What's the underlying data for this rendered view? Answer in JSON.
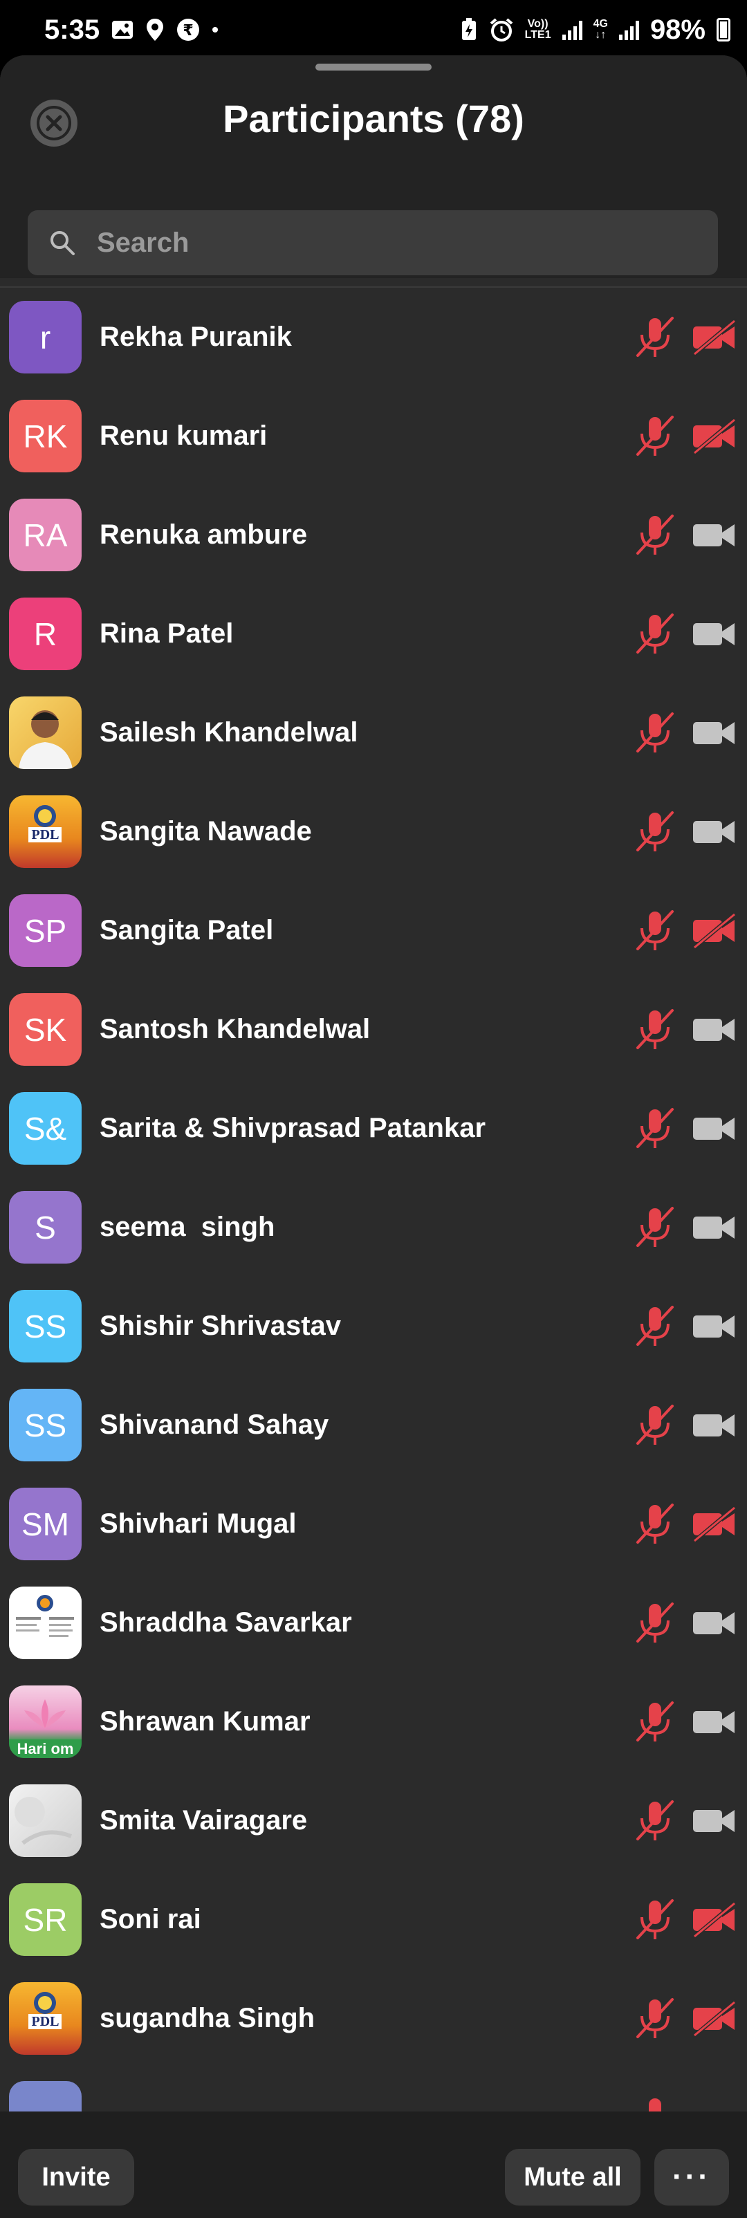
{
  "status_bar": {
    "time": "5:35",
    "battery": "98%",
    "net_top": "Vo)) ",
    "net_bottom": "LTE1",
    "net2_top": "4G",
    "net2_bottom": "↓↑"
  },
  "header": {
    "title": "Participants (78)"
  },
  "search": {
    "placeholder": "Search"
  },
  "colors": {
    "muted_red": "#e5424a",
    "cam_gray": "#c4c4c4",
    "background": "#2b2b2b"
  },
  "participants": [
    {
      "name": "Rekha Puranik",
      "initials": "r",
      "avatar_color": "#7e57c2",
      "camera": "off"
    },
    {
      "name": "Renu kumari",
      "initials": "RK",
      "avatar_color": "#f0605d",
      "camera": "off"
    },
    {
      "name": "Renuka ambure",
      "initials": "RA",
      "avatar_color": "#e68ab8",
      "camera": "on"
    },
    {
      "name": "Rina Patel",
      "initials": "R",
      "avatar_color": "#ec407a",
      "camera": "on"
    },
    {
      "name": "Sailesh Khandelwal",
      "initials": "",
      "avatar_color": "#f5c542",
      "avatar_type": "photo",
      "camera": "on"
    },
    {
      "name": "Sangita Nawade",
      "initials": "PDL",
      "avatar_color": "#f39c1f",
      "avatar_type": "logo",
      "camera": "on"
    },
    {
      "name": "Sangita Patel",
      "initials": "SP",
      "avatar_color": "#ba68c8",
      "camera": "off"
    },
    {
      "name": "Santosh Khandelwal",
      "initials": "SK",
      "avatar_color": "#f0605d",
      "camera": "on"
    },
    {
      "name": "Sarita & Shivprasad Patankar",
      "initials": "S&",
      "avatar_color": "#4fc3f7",
      "camera": "on"
    },
    {
      "name": "seema  singh",
      "initials": "S",
      "avatar_color": "#9575cd",
      "camera": "on"
    },
    {
      "name": "Shishir Shrivastav",
      "initials": "SS",
      "avatar_color": "#4fc3f7",
      "camera": "on"
    },
    {
      "name": "Shivanand Sahay",
      "initials": "SS",
      "avatar_color": "#64b5f6",
      "camera": "on"
    },
    {
      "name": "Shivhari Mugal",
      "initials": "SM",
      "avatar_color": "#9575cd",
      "camera": "off"
    },
    {
      "name": "Shraddha Savarkar",
      "initials": "",
      "avatar_color": "#ffffff",
      "avatar_type": "document",
      "camera": "on"
    },
    {
      "name": "Shrawan Kumar",
      "initials": "Hari om",
      "avatar_color": "#e58bb8",
      "avatar_type": "lotus",
      "camera": "on"
    },
    {
      "name": "Smita Vairagare",
      "initials": "",
      "avatar_color": "#e8e8e8",
      "avatar_type": "photo",
      "camera": "on"
    },
    {
      "name": "Soni rai",
      "initials": "SR",
      "avatar_color": "#9ccc65",
      "camera": "off"
    },
    {
      "name": "sugandha Singh",
      "initials": "PDL",
      "avatar_color": "#f39c1f",
      "avatar_type": "logo",
      "camera": "off"
    },
    {
      "name": "",
      "initials": "",
      "avatar_color": "#7986cb",
      "camera": "on"
    }
  ],
  "footer": {
    "invite_label": "Invite",
    "mute_all_label": "Mute all",
    "more_label": "···"
  }
}
